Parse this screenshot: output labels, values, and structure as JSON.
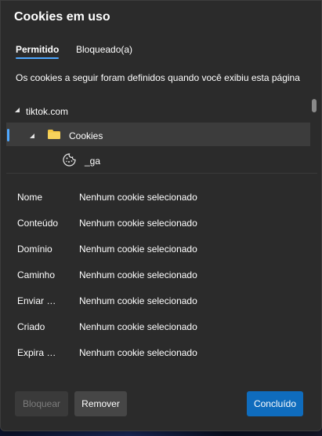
{
  "dialog": {
    "title": "Cookies em uso",
    "tabs": [
      {
        "label": "Permitido",
        "selected": true
      },
      {
        "label": "Bloqueado(a)",
        "selected": false
      }
    ],
    "description": "Os cookies a seguir foram definidos quando você exibiu esta página",
    "tree": [
      {
        "label": "tiktok.com",
        "icon": "expand-triangle-icon",
        "expanded": true
      },
      {
        "label": "Cookies",
        "icon": "folder-icon",
        "expanded": true,
        "selected": true
      },
      {
        "label": "_ga",
        "icon": "cookie-icon"
      }
    ],
    "details": [
      {
        "key": "Nome",
        "value": "Nenhum cookie selecionado"
      },
      {
        "key": "Conteúdo",
        "value": "Nenhum cookie selecionado"
      },
      {
        "key": "Domínio",
        "value": "Nenhum cookie selecionado"
      },
      {
        "key": "Caminho",
        "value": "Nenhum cookie selecionado"
      },
      {
        "key": "Enviar para",
        "value": "Nenhum cookie selecionado"
      },
      {
        "key": "Criado",
        "value": "Nenhum cookie selecionado"
      },
      {
        "key": "Expira em",
        "value": "Nenhum cookie selecionado"
      }
    ],
    "buttons": {
      "block": "Bloquear",
      "remove": "Remover",
      "done": "Concluído"
    }
  },
  "colors": {
    "accent": "#4fa8ff",
    "primary_button": "#0f6cbd",
    "folder": "#f5c842",
    "dialog_bg": "#2b2b2b"
  }
}
